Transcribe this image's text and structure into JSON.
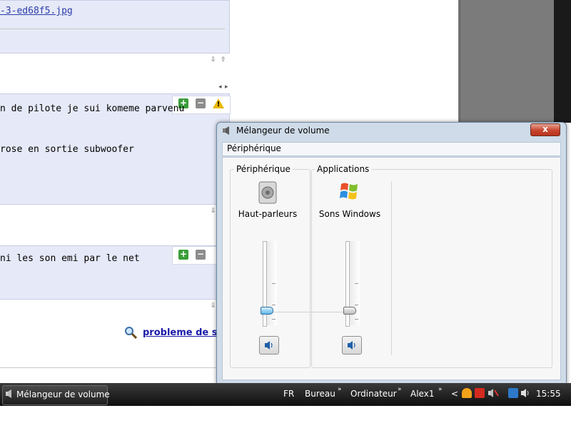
{
  "web": {
    "link_text": "-3-ed68f5.jpg",
    "post1_text": "n de pilote je sui komeme parvenu",
    "post1_text2": "rose en sortie subwoofer",
    "post2_text": "ni les son emi par le net",
    "search_link": "probleme de s",
    "btn_plus": "+",
    "btn_minus": "−",
    "warn_mark": "!",
    "arrow_down": "⇩",
    "arrow_up": "⇧",
    "arrow_left": "◂",
    "arrow_right": "▸"
  },
  "mixer": {
    "title": "Mélangeur de volume",
    "close_label": "x",
    "menu_item": "Périphérique",
    "device_group": "Périphérique",
    "apps_group": "Applications",
    "device_name": "Haut-parleurs",
    "app_name": "Sons Windows",
    "device_volume_fraction": 0.18,
    "app_volume_fraction": 0.18
  },
  "taskbar": {
    "task_button": "Mélangeur de volume",
    "language": "FR",
    "toolbars": [
      "Bureau",
      "Ordinateur",
      "Alex1"
    ],
    "chevron": "»",
    "collapse": "<",
    "clock": "15:55"
  },
  "colors": {
    "accent_link": "#2b3ea8",
    "close_red": "#c8452e",
    "slider_blue": "#5fb5e8"
  }
}
